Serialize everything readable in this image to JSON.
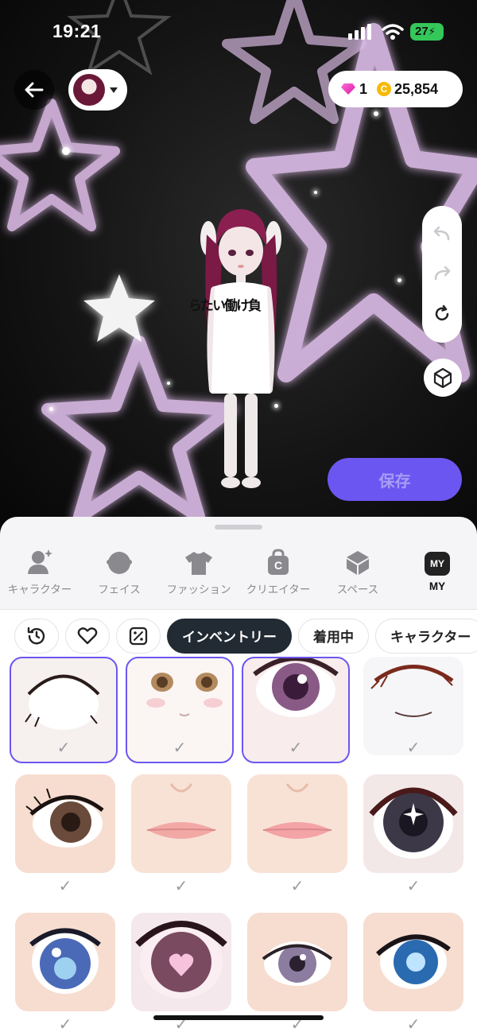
{
  "status_bar": {
    "time": "19:21",
    "battery": "27"
  },
  "header": {
    "gems": "1",
    "coins": "25,854",
    "coin_symbol": "C"
  },
  "save_button": {
    "label": "保存"
  },
  "character": {
    "shirt_text": "負\nけ\n働\nい\nた\nら"
  },
  "categories": [
    {
      "label": "キャラクター",
      "icon": "character-icon"
    },
    {
      "label": "フェイス",
      "icon": "face-icon"
    },
    {
      "label": "ファッション",
      "icon": "tshirt-icon"
    },
    {
      "label": "クリエイター",
      "icon": "creator-bag-icon",
      "badge": "C"
    },
    {
      "label": "スペース",
      "icon": "cube-icon"
    },
    {
      "label": "MY",
      "icon": "my-badge-icon",
      "badge": "MY",
      "active": true
    }
  ],
  "filters": [
    {
      "type": "icon",
      "icon": "history-icon"
    },
    {
      "type": "icon",
      "icon": "heart-icon"
    },
    {
      "type": "icon",
      "icon": "coupon-icon"
    },
    {
      "type": "text",
      "label": "インベントリー",
      "active": true
    },
    {
      "type": "text",
      "label": "着用中"
    },
    {
      "type": "text",
      "label": "キャラクター"
    }
  ],
  "items": [
    {
      "name": "eyelash-dark",
      "selected": true
    },
    {
      "name": "face-brown-eyes",
      "selected": true
    },
    {
      "name": "eye-purple",
      "selected": true
    },
    {
      "name": "eyelash-red",
      "selected": false
    },
    {
      "name": "eye-brown-lashes",
      "selected": false
    },
    {
      "name": "lips-pink-1",
      "selected": false
    },
    {
      "name": "lips-pink-2",
      "selected": false
    },
    {
      "name": "eye-dark-sparkle",
      "selected": false
    },
    {
      "name": "eye-blue-anime",
      "selected": false
    },
    {
      "name": "eye-heart-pink",
      "selected": false
    },
    {
      "name": "eye-lavender",
      "selected": false
    },
    {
      "name": "eye-blue-bright",
      "selected": false
    }
  ],
  "colors": {
    "accent": "#6c56f1",
    "dark_chip": "#222a33",
    "star_pink": "#e9c7f5"
  }
}
